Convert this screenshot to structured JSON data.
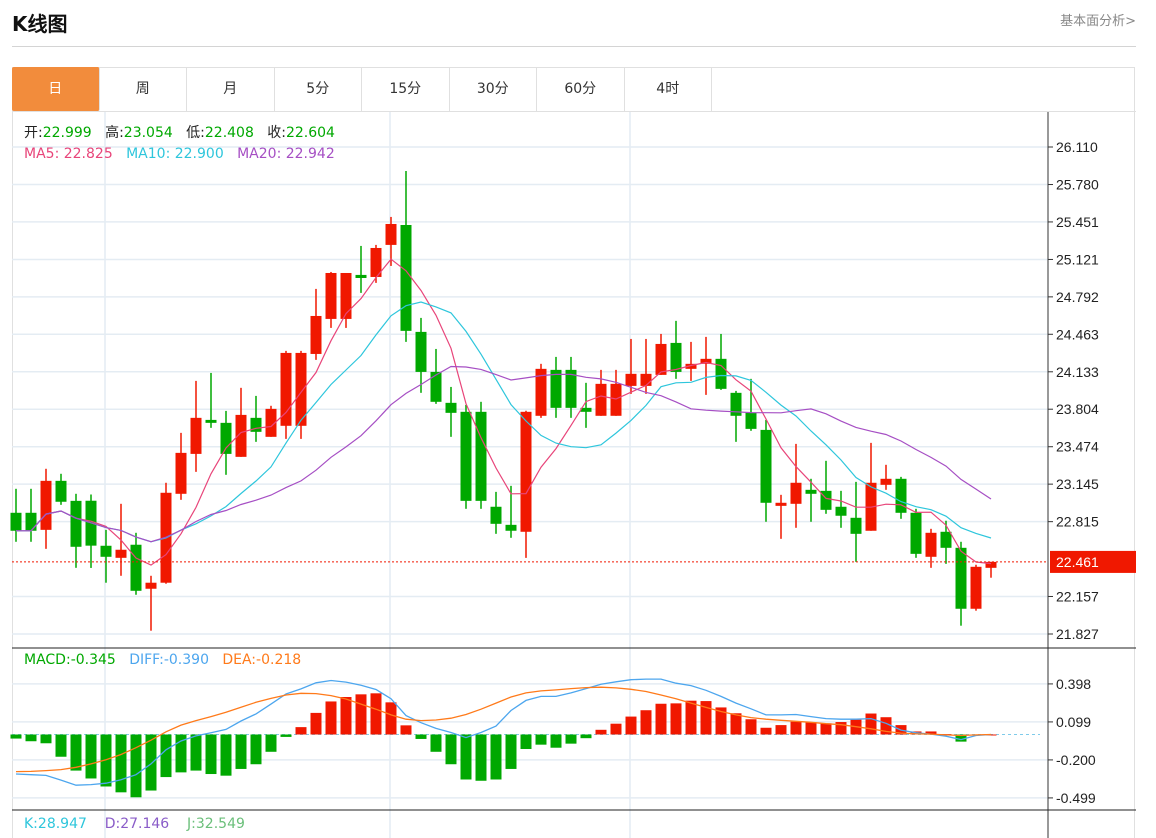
{
  "header": {
    "title": "K线图",
    "link": "基本面分析>"
  },
  "tabs": [
    "日",
    "周",
    "月",
    "5分",
    "15分",
    "30分",
    "60分",
    "4时"
  ],
  "active_tab": 0,
  "ohlc": {
    "open_label": "开:",
    "open": "22.999",
    "high_label": "高:",
    "high": "23.054",
    "low_label": "低:",
    "low": "22.408",
    "close_label": "收:",
    "close": "22.604"
  },
  "ma": {
    "ma5_label": "MA5:",
    "ma5": "22.825",
    "ma10_label": "MA10:",
    "ma10": "22.900",
    "ma20_label": "MA20:",
    "ma20": "22.942"
  },
  "macd_info": {
    "macd_label": "MACD:",
    "macd": "-0.345",
    "diff_label": "DIFF:",
    "diff": "-0.390",
    "dea_label": "DEA:",
    "dea": "-0.218"
  },
  "kdj_info": {
    "k_label": "K:",
    "k": "28.947",
    "d_label": "D:",
    "d": "27.146",
    "j_label": "J:",
    "j": "32.549"
  },
  "colors": {
    "up": "#f01800",
    "down": "#00a800",
    "ma5": "#e8457a",
    "ma10": "#2ec6dc",
    "ma20": "#a64fc4",
    "diff": "#4da6ee",
    "dea": "#ff7a1a",
    "accent": "#f28c3c",
    "k": "#2ec6dc",
    "d": "#8a5cc8",
    "j": "#6bbf7a"
  },
  "chart_data": {
    "type": "candlestick",
    "candle_format": [
      "open",
      "high",
      "low",
      "close"
    ],
    "candles": [
      [
        22.893,
        23.104,
        22.638,
        22.735
      ],
      [
        22.893,
        23.104,
        22.638,
        22.735
      ],
      [
        22.743,
        23.28,
        22.576,
        23.174
      ],
      [
        23.174,
        23.236,
        22.963,
        22.99
      ],
      [
        22.998,
        23.06,
        22.409,
        22.594
      ],
      [
        22.999,
        23.054,
        22.408,
        22.604
      ],
      [
        22.603,
        22.743,
        22.278,
        22.506
      ],
      [
        22.497,
        22.972,
        22.339,
        22.568
      ],
      [
        22.612,
        22.717,
        22.172,
        22.207
      ],
      [
        22.225,
        22.339,
        21.856,
        22.278
      ],
      [
        22.278,
        23.157,
        22.269,
        23.069
      ],
      [
        23.06,
        23.596,
        23.007,
        23.42
      ],
      [
        23.411,
        24.053,
        23.253,
        23.728
      ],
      [
        23.71,
        24.123,
        23.64,
        23.684
      ],
      [
        23.684,
        23.789,
        23.227,
        23.411
      ],
      [
        23.385,
        23.992,
        23.385,
        23.754
      ],
      [
        23.728,
        23.921,
        23.517,
        23.605
      ],
      [
        23.561,
        23.834,
        23.561,
        23.807
      ],
      [
        23.658,
        24.317,
        23.543,
        24.299
      ],
      [
        23.658,
        24.317,
        23.543,
        24.299
      ],
      [
        24.29,
        24.862,
        24.238,
        24.624
      ],
      [
        24.598,
        25.011,
        24.519,
        25.002
      ],
      [
        24.598,
        25.002,
        24.519,
        25.002
      ],
      [
        24.985,
        25.24,
        24.827,
        24.958
      ],
      [
        24.967,
        25.249,
        24.915,
        25.222
      ],
      [
        25.249,
        25.495,
        25.064,
        25.433
      ],
      [
        25.424,
        25.899,
        24.396,
        24.493
      ],
      [
        24.484,
        24.607,
        23.948,
        24.132
      ],
      [
        24.132,
        24.334,
        23.851,
        23.869
      ],
      [
        23.86,
        24.0,
        23.561,
        23.772
      ],
      [
        23.781,
        23.842,
        22.928,
        22.998
      ],
      [
        23.781,
        23.869,
        22.928,
        22.998
      ],
      [
        22.946,
        23.077,
        22.708,
        22.796
      ],
      [
        22.787,
        23.13,
        22.673,
        22.735
      ],
      [
        22.726,
        23.79,
        22.497,
        23.781
      ],
      [
        23.746,
        24.203,
        23.728,
        24.159
      ],
      [
        24.15,
        24.264,
        23.728,
        23.816
      ],
      [
        24.15,
        24.264,
        23.728,
        23.816
      ],
      [
        23.816,
        24.036,
        23.64,
        23.781
      ],
      [
        23.746,
        24.15,
        23.746,
        24.027
      ],
      [
        23.746,
        24.15,
        23.746,
        24.027
      ],
      [
        24.009,
        24.422,
        23.939,
        24.115
      ],
      [
        24.009,
        24.422,
        23.939,
        24.115
      ],
      [
        24.106,
        24.466,
        24.106,
        24.378
      ],
      [
        24.387,
        24.581,
        24.071,
        24.132
      ],
      [
        24.159,
        24.396,
        24.053,
        24.203
      ],
      [
        24.203,
        24.44,
        23.93,
        24.247
      ],
      [
        24.247,
        24.466,
        23.974,
        23.983
      ],
      [
        23.948,
        23.965,
        23.517,
        23.746
      ],
      [
        23.772,
        24.071,
        23.614,
        23.631
      ],
      [
        23.622,
        23.71,
        22.814,
        22.981
      ],
      [
        22.954,
        23.051,
        22.664,
        22.981
      ],
      [
        22.972,
        23.499,
        22.761,
        23.157
      ],
      [
        23.095,
        23.192,
        22.814,
        23.06
      ],
      [
        23.086,
        23.35,
        22.884,
        22.919
      ],
      [
        22.946,
        23.086,
        22.761,
        22.867
      ],
      [
        22.849,
        23.165,
        22.462,
        22.708
      ],
      [
        22.735,
        23.508,
        22.735,
        23.157
      ],
      [
        23.139,
        23.315,
        23.095,
        23.192
      ],
      [
        23.192,
        23.209,
        22.84,
        22.893
      ],
      [
        22.893,
        22.928,
        22.497,
        22.532
      ],
      [
        22.506,
        22.752,
        22.409,
        22.717
      ],
      [
        22.726,
        22.823,
        22.444,
        22.585
      ],
      [
        22.585,
        22.638,
        21.9,
        22.049
      ],
      [
        22.049,
        22.436,
        22.032,
        22.418
      ],
      [
        22.409,
        22.462,
        22.322,
        22.461
      ]
    ],
    "ma_periods": [
      5,
      10,
      20
    ],
    "price_axis": {
      "ticks": [
        "26.110",
        "25.780",
        "25.451",
        "25.121",
        "24.792",
        "24.463",
        "24.133",
        "23.804",
        "23.474",
        "23.145",
        "22.815",
        "22.157",
        "21.827"
      ],
      "range": [
        21.827,
        26.11
      ]
    },
    "current_price": "22.461",
    "macd": {
      "hist": [
        -0.032,
        -0.053,
        -0.069,
        -0.175,
        -0.284,
        -0.346,
        -0.409,
        -0.455,
        -0.494,
        -0.441,
        -0.335,
        -0.298,
        -0.284,
        -0.311,
        -0.324,
        -0.271,
        -0.234,
        -0.136,
        -0.019,
        0.058,
        0.17,
        0.26,
        0.295,
        0.316,
        0.324,
        0.253,
        0.072,
        -0.035,
        -0.136,
        -0.234,
        -0.354,
        -0.364,
        -0.354,
        -0.271,
        -0.114,
        -0.08,
        -0.104,
        -0.072,
        -0.029,
        0.037,
        0.085,
        0.141,
        0.191,
        0.242,
        0.245,
        0.266,
        0.263,
        0.213,
        0.167,
        0.12,
        0.053,
        0.074,
        0.101,
        0.096,
        0.088,
        0.098,
        0.117,
        0.165,
        0.136,
        0.074,
        0.024,
        0.024,
        0.003,
        -0.056,
        0,
        0
      ],
      "diff": [
        -0.311,
        -0.316,
        -0.322,
        -0.359,
        -0.399,
        -0.394,
        -0.383,
        -0.356,
        -0.316,
        -0.231,
        -0.12,
        -0.051,
        -0.011,
        0.013,
        0.04,
        0.106,
        0.162,
        0.239,
        0.319,
        0.359,
        0.407,
        0.425,
        0.412,
        0.388,
        0.354,
        0.282,
        0.149,
        0.093,
        0.048,
        0.016,
        -0.024,
        0.016,
        0.066,
        0.189,
        0.268,
        0.3,
        0.3,
        0.327,
        0.361,
        0.396,
        0.415,
        0.431,
        0.436,
        0.436,
        0.404,
        0.385,
        0.348,
        0.3,
        0.247,
        0.202,
        0.154,
        0.154,
        0.157,
        0.141,
        0.125,
        0.12,
        0.12,
        0.125,
        0.088,
        0.035,
        0.013,
        0.003,
        -0.013,
        -0.04,
        -0.008,
        0
      ],
      "dea": [
        -0.292,
        -0.29,
        -0.284,
        -0.276,
        -0.258,
        -0.231,
        -0.199,
        -0.157,
        -0.104,
        -0.045,
        0.021,
        0.074,
        0.109,
        0.141,
        0.175,
        0.215,
        0.253,
        0.284,
        0.311,
        0.324,
        0.322,
        0.306,
        0.279,
        0.239,
        0.199,
        0.154,
        0.12,
        0.109,
        0.114,
        0.128,
        0.157,
        0.199,
        0.247,
        0.295,
        0.327,
        0.343,
        0.351,
        0.361,
        0.369,
        0.372,
        0.367,
        0.356,
        0.338,
        0.311,
        0.282,
        0.247,
        0.213,
        0.181,
        0.154,
        0.133,
        0.12,
        0.112,
        0.104,
        0.096,
        0.085,
        0.077,
        0.061,
        0.045,
        0.024,
        0.011,
        0.005,
        0.003,
        -0.003,
        -0.008,
        -0.003,
        0
      ],
      "axis_ticks": [
        "0.398",
        "0.099",
        "-0.200",
        "-0.499"
      ],
      "axis_values": [
        0.398,
        0.099,
        -0.2,
        -0.499
      ]
    }
  }
}
